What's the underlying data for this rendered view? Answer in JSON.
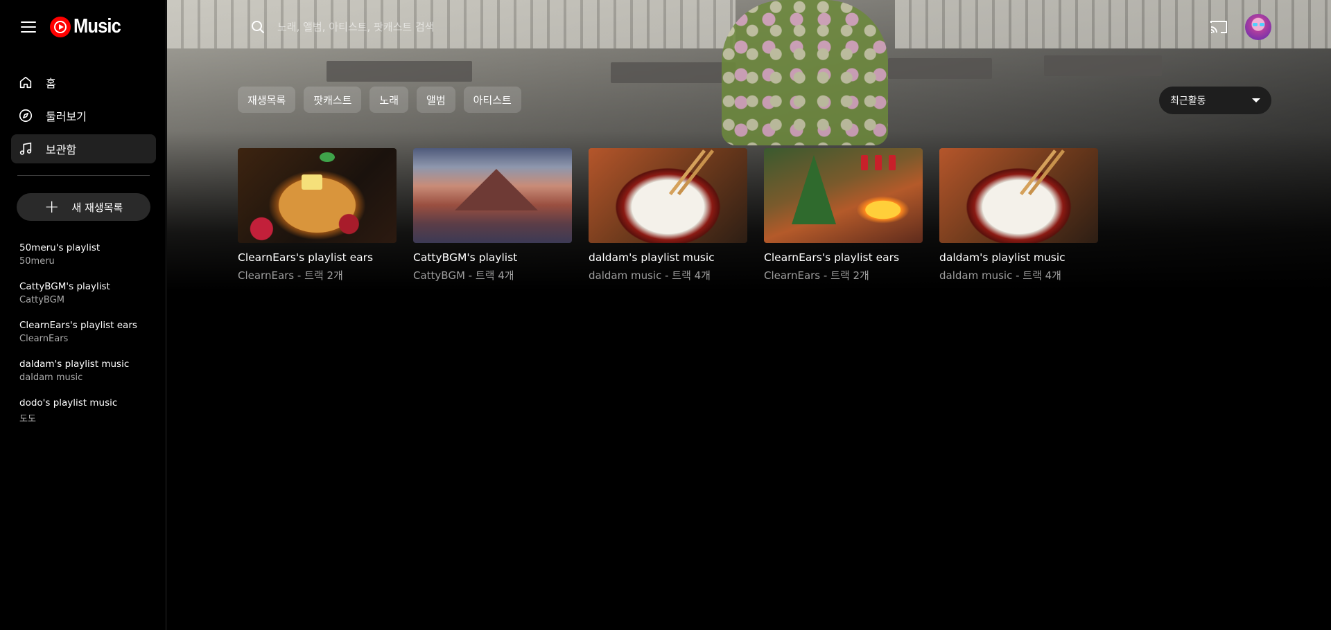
{
  "app": {
    "logo_text": "Music"
  },
  "search": {
    "placeholder": "노래, 앨범, 아티스트, 팟캐스트 검색"
  },
  "nav": {
    "items": [
      {
        "label": "홈",
        "icon": "home-icon"
      },
      {
        "label": "둘러보기",
        "icon": "compass-icon"
      },
      {
        "label": "보관함",
        "icon": "music-note-icon",
        "active": true
      }
    ]
  },
  "new_playlist": {
    "label": "새 재생목록"
  },
  "sidebar_playlists": [
    {
      "title": "50meru's playlist",
      "owner": "50meru"
    },
    {
      "title": "CattyBGM's playlist",
      "owner": "CattyBGM"
    },
    {
      "title": "ClearnEars's playlist ears",
      "owner": "ClearnEars"
    },
    {
      "title": "daldam's playlist music",
      "owner": "daldam music"
    },
    {
      "title": "dodo's playlist music",
      "owner": "도도"
    }
  ],
  "chips": [
    "재생목록",
    "팟캐스트",
    "노래",
    "앨범",
    "아티스트"
  ],
  "sort": {
    "label": "최근활동"
  },
  "cards": [
    {
      "title": "ClearnEars's playlist ears",
      "subtitle": "ClearnEars - 트랙 2개",
      "art": "pancakes"
    },
    {
      "title": "CattyBGM's playlist",
      "subtitle": "CattyBGM - 트랙 4개",
      "art": "volcanic-mountains"
    },
    {
      "title": "daldam's playlist music",
      "subtitle": "daldam music - 트랙 4개",
      "art": "rice-bowl"
    },
    {
      "title": "ClearnEars's playlist ears",
      "subtitle": "ClearnEars - 트랙 2개",
      "art": "christmas-fireplace"
    },
    {
      "title": "daldam's playlist music",
      "subtitle": "daldam music - 트랙 4개",
      "art": "rice-bowl"
    }
  ],
  "colors": {
    "brand_red": "#ff0000",
    "background": "#000000",
    "active_nav": "#212121"
  }
}
